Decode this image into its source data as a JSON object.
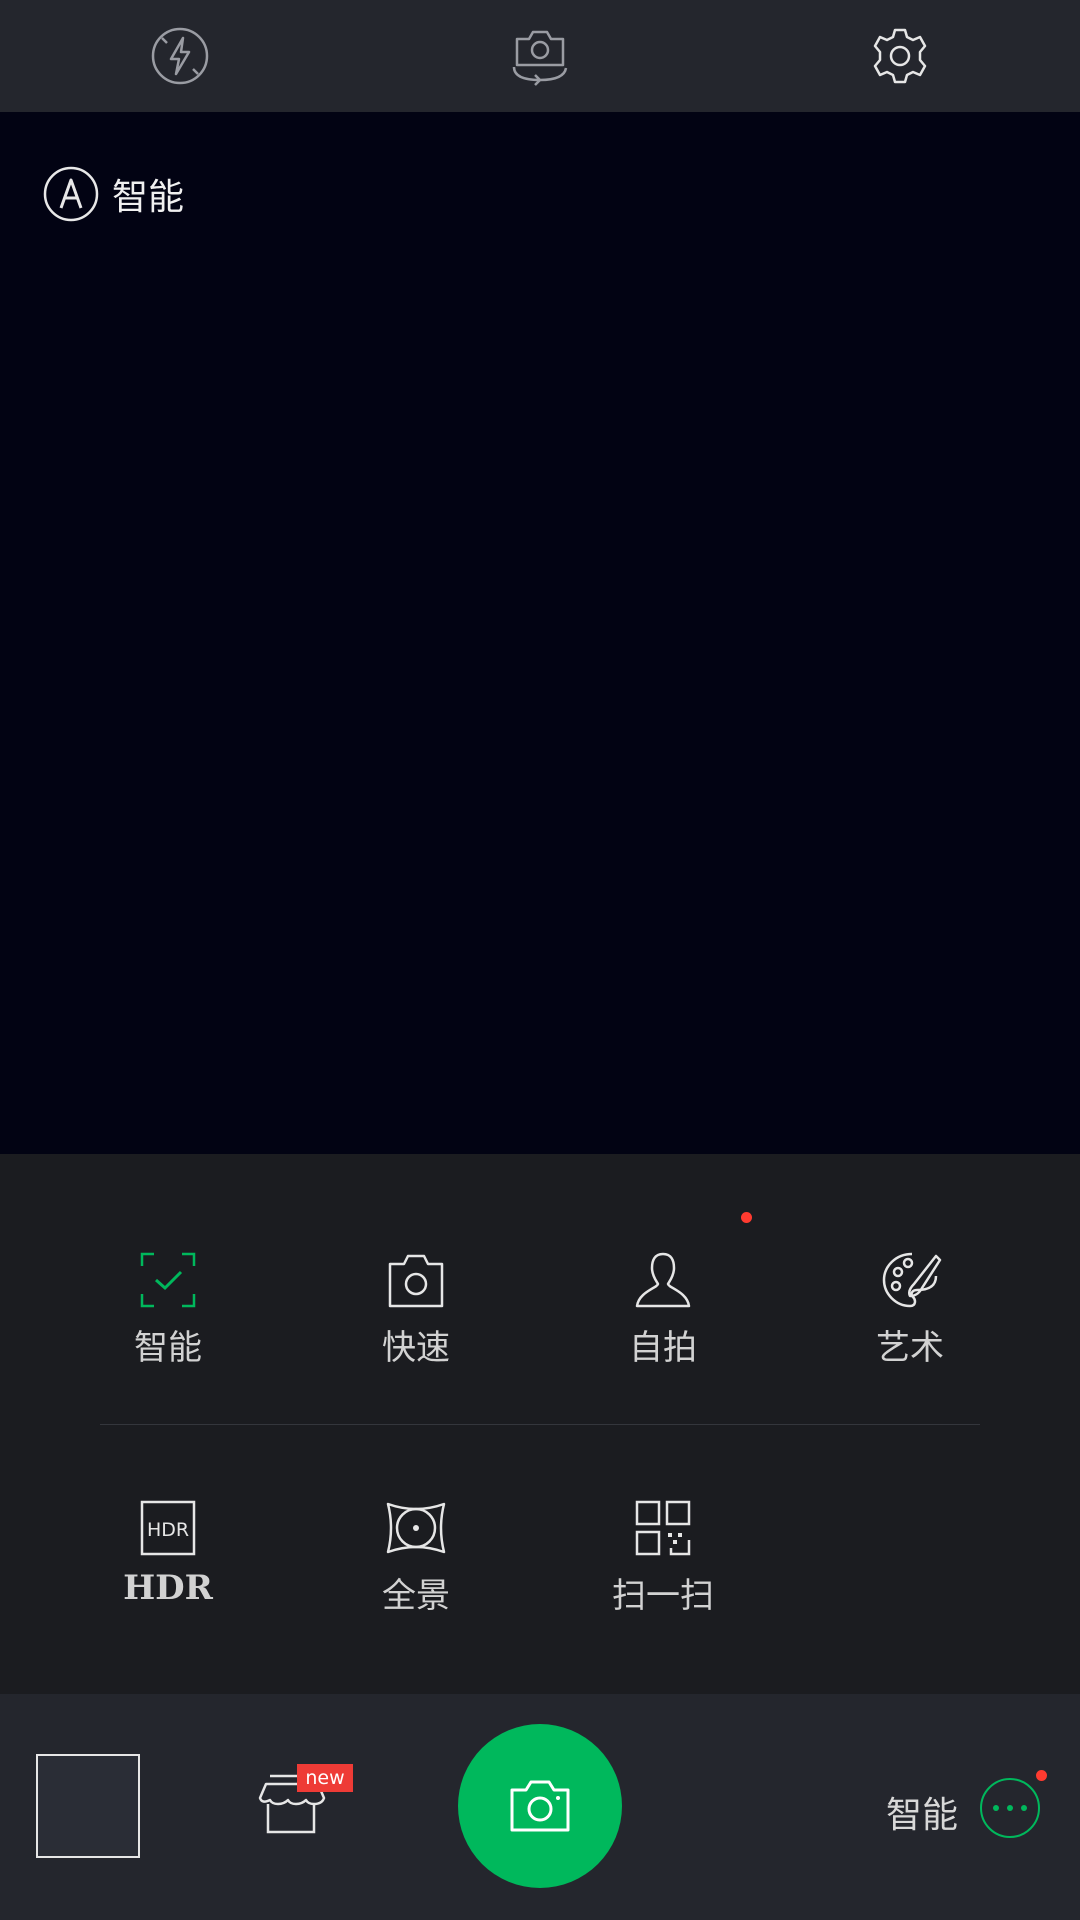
{
  "topbar": {
    "icons": [
      "flash-auto-icon",
      "switch-camera-icon",
      "settings-gear-icon"
    ]
  },
  "viewfinder": {
    "mode_badge": "智能"
  },
  "modes": {
    "row1": [
      {
        "label": "智能",
        "icon": "smart-frame-check-icon",
        "active": true
      },
      {
        "label": "快速",
        "icon": "camera-icon"
      },
      {
        "label": "自拍",
        "icon": "person-icon",
        "has_dot": true
      },
      {
        "label": "艺术",
        "icon": "palette-icon"
      }
    ],
    "row2": [
      {
        "label": "HDR",
        "icon": "hdr-icon",
        "icon_text": "HDR"
      },
      {
        "label": "全景",
        "icon": "panorama-icon"
      },
      {
        "label": "扫一扫",
        "icon": "qr-scan-icon"
      }
    ]
  },
  "bottombar": {
    "new_badge": "new",
    "current_mode": "智能"
  },
  "colors": {
    "accent": "#00b85c",
    "badge_red": "#ee3b36",
    "dot_red": "#ff3b30"
  }
}
